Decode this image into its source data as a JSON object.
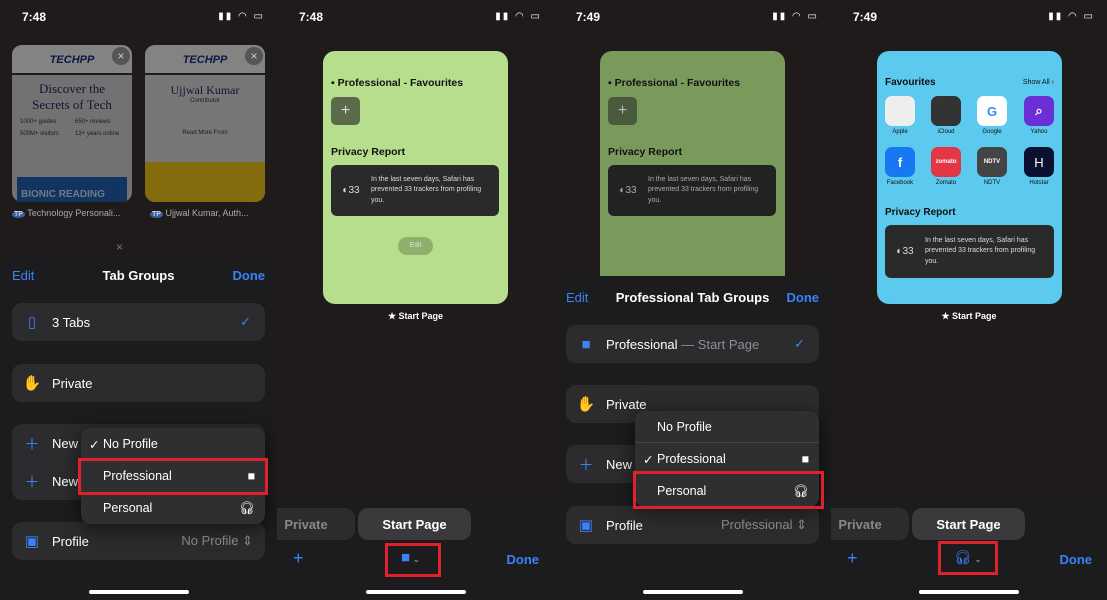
{
  "panel1": {
    "time": "7:48",
    "thumbs": [
      {
        "title": "Technology Personali...",
        "head": "Discover the Secrets of Tech",
        "brand": "TECHPP",
        "stats": [
          "1000+ guides",
          "650+ reviews",
          "500M+ visitors",
          "13+ years online"
        ],
        "banner": "BIONIC READING"
      },
      {
        "title": "Ujjwal Kumar, Auth...",
        "head": "Ujjwal Kumar",
        "sub": "Contributor",
        "more": "Read More From",
        "brand": "TECHPP"
      }
    ],
    "sheet": {
      "edit": "Edit",
      "title": "Tab Groups",
      "done": "Done",
      "rows": [
        "3 Tabs",
        "Private",
        "New",
        "New"
      ],
      "profile_label": "Profile",
      "profile_value": "No Profile"
    },
    "menu": [
      {
        "label": "No Profile",
        "checked": true
      },
      {
        "label": "Professional",
        "icon": "briefcase-icon"
      },
      {
        "label": "Personal",
        "icon": "headphones-icon"
      }
    ]
  },
  "panel2": {
    "time": "7:48",
    "card": {
      "title": "Professional - Favourites",
      "privacy": "Privacy Report",
      "count": "33",
      "text": "In the last seven days, Safari has prevented 33 trackers from profiling you.",
      "edit": "Edit",
      "color": "#b7de8c"
    },
    "caption": "Start Page",
    "tabs": [
      "Private",
      "Start Page"
    ],
    "done": "Done"
  },
  "panel3": {
    "time": "7:49",
    "sheet": {
      "edit": "Edit",
      "title": "Professional Tab Groups",
      "done": "Done",
      "row1": "Professional",
      "row1_sub": "— Start Page",
      "private": "Private",
      "new": "New",
      "profile_label": "Profile",
      "profile_value": "Professional"
    },
    "menu": [
      {
        "label": "No Profile"
      },
      {
        "label": "Professional",
        "checked": true,
        "icon": "briefcase-icon"
      },
      {
        "label": "Personal",
        "icon": "headphones-icon"
      }
    ]
  },
  "panel4": {
    "time": "7:49",
    "card": {
      "favs_title": "Favourites",
      "show_all": "Show All",
      "favs": [
        "Apple",
        "iCloud",
        "Google",
        "Yahoo",
        "Facebook",
        "Zomato",
        "NDTV",
        "Hotstar"
      ],
      "privacy": "Privacy Report",
      "count": "33",
      "text": "In the last seven days, Safari has prevented 33 trackers from profiling you.",
      "color": "#5cc9ef"
    },
    "caption": "Start Page",
    "tabs": [
      "Private",
      "Start Page"
    ],
    "done": "Done"
  },
  "colors": {
    "accent": "#3b82f6",
    "highlight": "#e0202a"
  }
}
